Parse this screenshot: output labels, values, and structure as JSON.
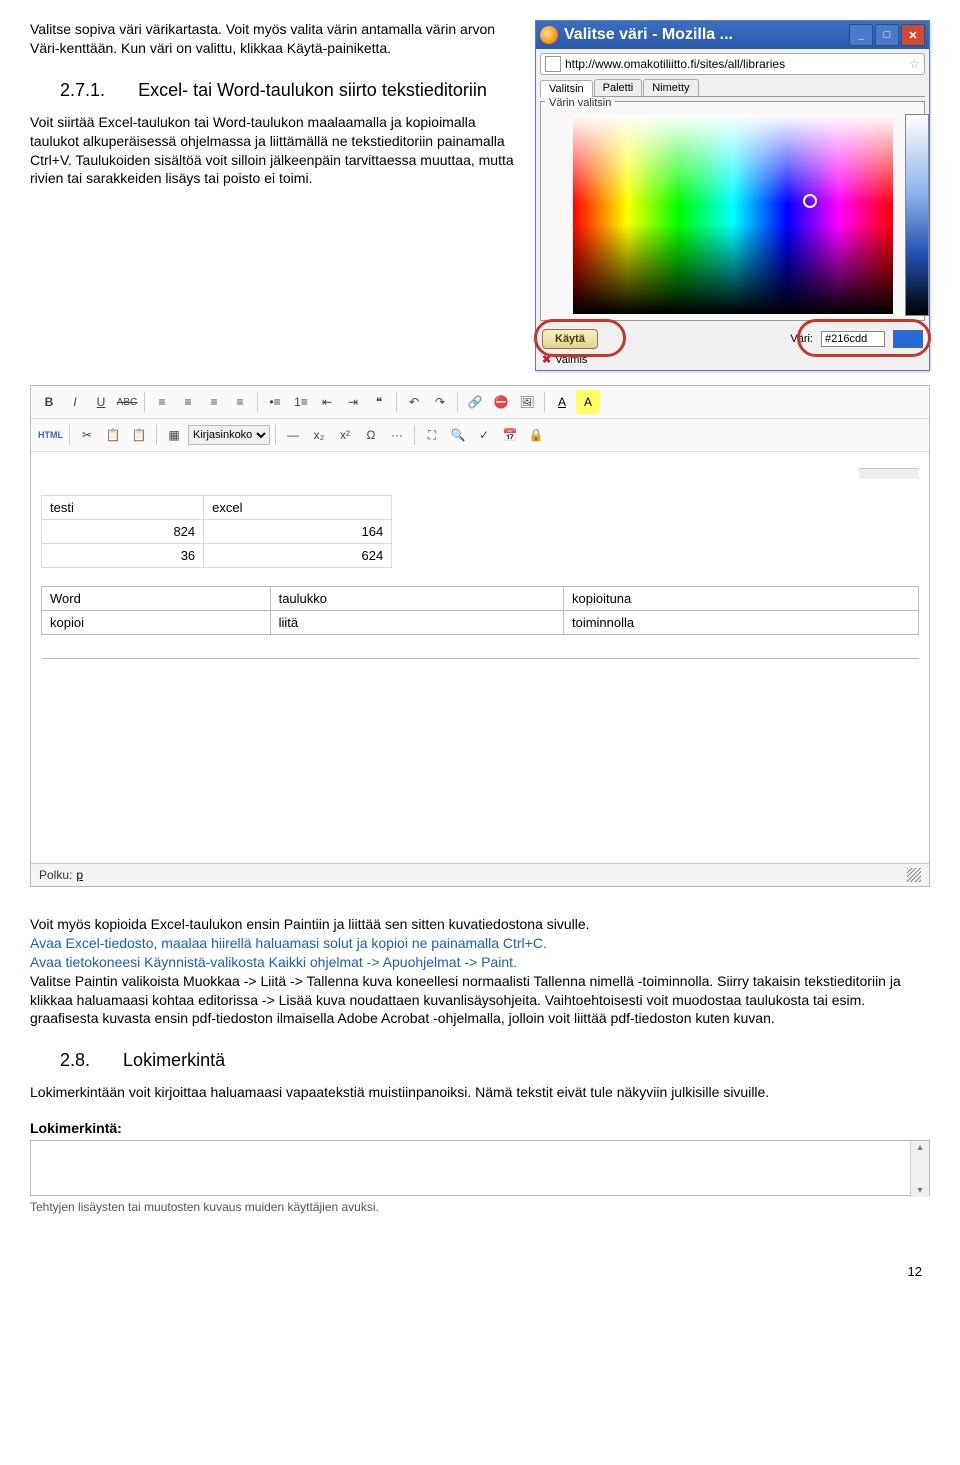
{
  "intro1": "Valitse sopiva väri värikartasta. Voit myös valita värin antamalla värin arvon Väri-kenttään. Kun väri on valittu, klikkaa Käytä-painiketta.",
  "section271": {
    "num": "2.7.1.",
    "title": "Excel- tai Word-taulukon siirto tekstieditoriin"
  },
  "intro2": "Voit siirtää Excel-taulukon tai Word-taulukon maalaamalla ja kopioimalla taulukot alkuperäisessä ohjelmassa ja liittämällä ne tekstieditoriin painamalla Ctrl+V. Taulukoiden sisältöä voit silloin jälkeenpäin tarvittaessa muuttaa, mutta rivien tai sarakkeiden lisäys tai poisto ei toimi.",
  "moz": {
    "title": "Valitse väri - Mozilla ...",
    "url": "http://www.omakotiliitto.fi/sites/all/libraries",
    "tabs": [
      "Valitsin",
      "Paletti",
      "Nimetty"
    ],
    "legend": "Värin valitsin",
    "kayta": "Käytä",
    "vari_label": "Väri:",
    "vari_value": "#216cdd",
    "valmis": "Valmis"
  },
  "toolbar": {
    "r1": {
      "bold": "B",
      "italic": "I",
      "underline": "U",
      "strike": "ABC",
      "al": "≡",
      "ac": "≡",
      "ar": "≡",
      "aj": "≡",
      "bl": "•≡",
      "nl": "1≡",
      "out": "⇤",
      "in": "⇥",
      "quote": "❝",
      "undo": "↶",
      "redo": "↷",
      "link": "🔗",
      "unlink": "⛔",
      "img": "🖼",
      "fg": "A",
      "bg": "A"
    },
    "r2": {
      "html": "HTML",
      "cut": "✂",
      "copy": "📋",
      "paste": "📋",
      "tbl": "▦",
      "size_label": "Kirjasinkoko",
      "hr": "—",
      "sub": "x₂",
      "sup": "x²",
      "char": "Ω",
      "pb": "···",
      "full": "⛶",
      "find": "🔍",
      "spell": "✓",
      "cal": "📅",
      "lock": "🔒"
    }
  },
  "table1": {
    "r1": [
      "testi",
      "excel"
    ],
    "r2": [
      "824",
      "164"
    ],
    "r3": [
      "36",
      "624"
    ]
  },
  "table2": {
    "r1": [
      "Word",
      "taulukko",
      "kopioituna"
    ],
    "r2": [
      "kopioi",
      "liitä",
      "toiminnolla"
    ]
  },
  "path": {
    "label": "Polku:",
    "value": "p"
  },
  "below": "Voit myös kopioida Excel-taulukon ensin Paintiin ja liittää sen sitten kuvatiedostona sivulle.\nAvaa Excel-tiedosto, maalaa hiirellä haluamasi solut ja kopioi ne painamalla Ctrl+C.\nAvaa tietokoneesi Käynnistä-valikosta Kaikki ohjelmat -> Apuohjelmat -> Paint.\nValitse Paintin valikoista Muokkaa -> Liitä -> Tallenna kuva koneellesi normaalisti Tallenna nimellä -toiminnolla. Siirry takaisin tekstieditoriin ja klikkaa haluamaasi kohtaa editorissa -> Lisää kuva noudattaen kuvanlisäysohjeita. Vaihtoehtoisesti voit muodostaa taulukosta tai esim. graafisesta kuvasta ensin pdf-tiedoston ilmaisella Adobe Acrobat -ohjelmalla, jolloin voit liittää pdf-tiedoston kuten kuvan.",
  "section28": {
    "num": "2.8.",
    "title": "Lokimerkintä"
  },
  "loki_intro": "Lokimerkintään voit kirjoittaa haluamaasi vapaatekstiä muistiinpanoiksi. Nämä tekstit eivät tule näkyviin julkisille sivuille.",
  "loki": {
    "label": "Lokimerkintä:",
    "desc": "Tehtyjen lisäysten tai muutosten kuvaus muiden käyttäjien avuksi."
  },
  "page_number": "12"
}
